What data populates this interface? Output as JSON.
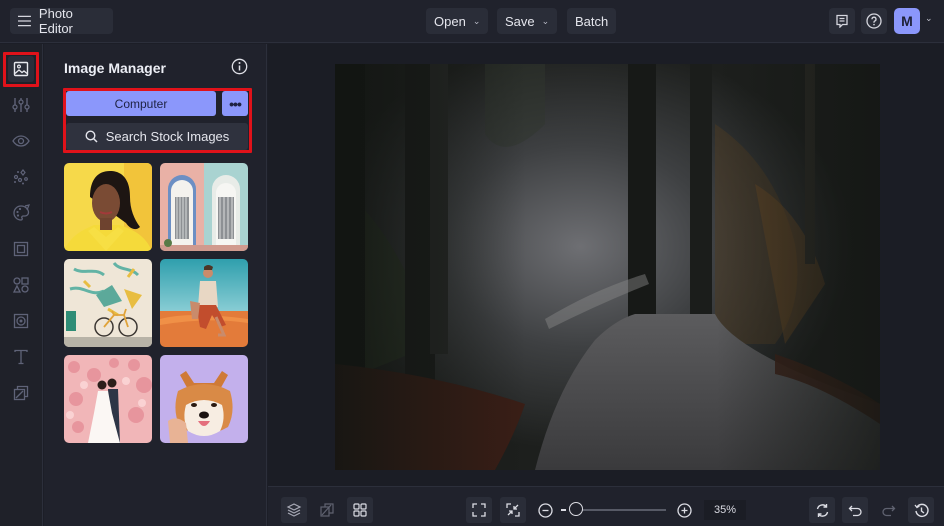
{
  "app": {
    "title": "Photo Editor"
  },
  "topbar": {
    "open_label": "Open",
    "save_label": "Save",
    "batch_label": "Batch",
    "avatar_initial": "M",
    "icons": [
      "menu-icon",
      "feedback-icon",
      "help-icon",
      "chevron-down-icon"
    ]
  },
  "rail": {
    "items": [
      {
        "name": "image-manager",
        "icon": "image-icon",
        "active": true
      },
      {
        "name": "adjustments",
        "icon": "sliders-icon",
        "active": false
      },
      {
        "name": "effects",
        "icon": "eye-icon",
        "active": false
      },
      {
        "name": "touch-up",
        "icon": "sparkle-icon",
        "active": false
      },
      {
        "name": "artsy",
        "icon": "palette-icon",
        "active": false
      },
      {
        "name": "frames",
        "icon": "frame-icon",
        "active": false
      },
      {
        "name": "graphics",
        "icon": "shapes-icon",
        "active": false
      },
      {
        "name": "overlays",
        "icon": "texture-icon",
        "active": false
      },
      {
        "name": "text",
        "icon": "text-icon",
        "active": false
      },
      {
        "name": "layers-mask",
        "icon": "layers-icon",
        "active": false
      }
    ]
  },
  "panel": {
    "title": "Image Manager",
    "computer_label": "Computer",
    "more_label": "•••",
    "stock_label": "Search Stock Images",
    "thumbnails": [
      {
        "name": "woman-portrait-yellow"
      },
      {
        "name": "doors-pastel"
      },
      {
        "name": "bicycle-mural"
      },
      {
        "name": "man-sitting-desert"
      },
      {
        "name": "wedding-couple-blossoms"
      },
      {
        "name": "shiba-dog-purple"
      }
    ]
  },
  "canvas": {
    "image": "foggy-forest-path"
  },
  "bottombar": {
    "zoom_percent": "35%",
    "zoom_level": 0.05,
    "icons": [
      "layers-icon",
      "compare-icon",
      "grid-icon",
      "fit-screen-icon",
      "actual-size-icon",
      "zoom-out-icon",
      "zoom-in-icon",
      "reset-icon",
      "undo-icon",
      "redo-icon",
      "history-icon"
    ]
  },
  "colors": {
    "accent": "#8b97fb",
    "highlight": "#e0121a",
    "background": "#1c1e27"
  }
}
